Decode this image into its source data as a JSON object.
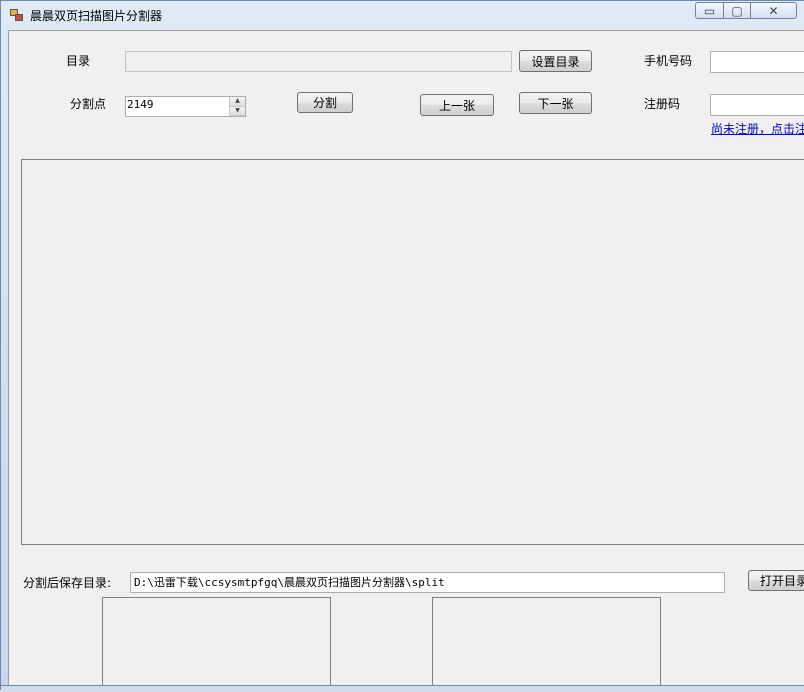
{
  "window": {
    "title": "晨晨双页扫描图片分割器",
    "controls": {
      "minimize": "▭",
      "maximize": "▢",
      "close": "✕"
    }
  },
  "form": {
    "dir_label": "目录",
    "dir_value": "",
    "set_dir_button": "设置目录",
    "phone_label": "手机号码",
    "phone_value": "",
    "split_point_label": "分割点",
    "split_point_value": "2149",
    "split_button": "分割",
    "prev_button": "上一张",
    "next_button": "下一张",
    "reg_code_label": "注册码",
    "reg_code_value": "",
    "register_link": "尚未注册，点击注"
  },
  "footer": {
    "save_dir_label": "分割后保存目录:",
    "save_dir_value": "D:\\迅雷下载\\ccsysmtpfgq\\晨晨双页扫描图片分割器\\split",
    "open_dir_button": "打开目录"
  },
  "icons": {
    "app": "app-icon",
    "spin_up": "▲",
    "spin_down": "▼"
  }
}
